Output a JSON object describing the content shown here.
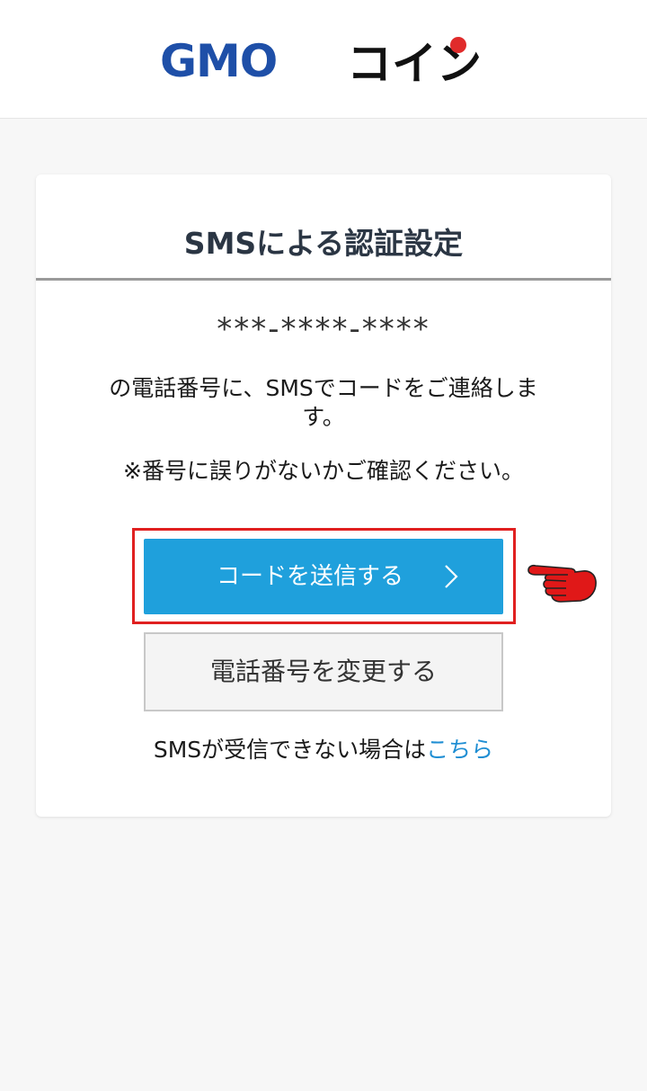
{
  "header": {
    "logo": {
      "text_gmo": "GMO",
      "text_coin": "コイン",
      "colors": {
        "gmo": "#1e4fa8",
        "coin": "#111111",
        "dot": "#e02b2b"
      }
    }
  },
  "card": {
    "title": "SMSによる認証設定",
    "masked_phone": "***-****-****",
    "message": "の電話番号に、SMSでコードをご連絡します。",
    "note": "※番号に誤りがないかご確認ください。",
    "send_button": {
      "label": "コードを送信する",
      "icon": "chevron-right-icon",
      "color": "#1fa0dc"
    },
    "change_button": {
      "label": "電話番号を変更する"
    },
    "sms_help": {
      "text": "SMSが受信できない場合は",
      "link_text": "こちら"
    }
  },
  "annotation": {
    "highlight_color": "#e02020",
    "pointer_icon": "pointing-hand-icon"
  }
}
